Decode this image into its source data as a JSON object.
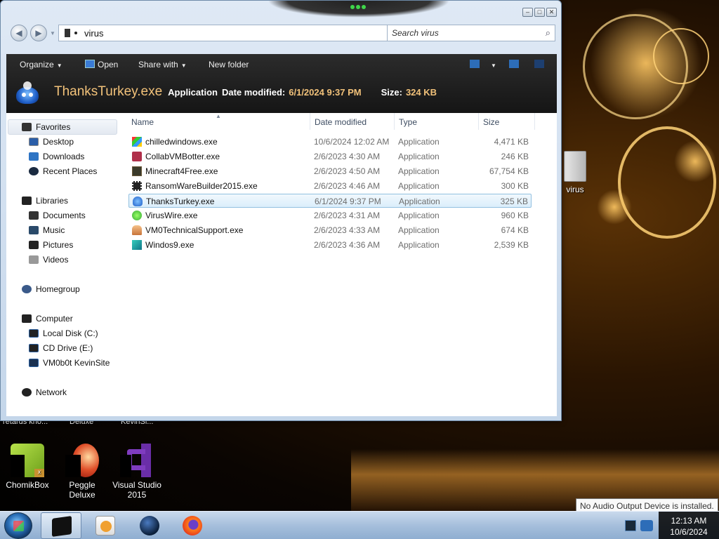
{
  "window": {
    "address": "virus",
    "search_placeholder": "Search virus",
    "toolbar": {
      "organize": "Organize",
      "open": "Open",
      "share_with": "Share with",
      "new_folder": "New folder"
    },
    "details": {
      "name": "ThanksTurkey.exe",
      "type": "Application",
      "date_label": "Date modified:",
      "date_value": "6/1/2024 9:37 PM",
      "size_label": "Size:",
      "size_value": "324 KB"
    },
    "nav": {
      "favorites": "Favorites",
      "desktop": "Desktop",
      "downloads": "Downloads",
      "recent_places": "Recent Places",
      "libraries": "Libraries",
      "documents": "Documents",
      "music": "Music",
      "pictures": "Pictures",
      "videos": "Videos",
      "homegroup": "Homegroup",
      "computer": "Computer",
      "local_disk": "Local Disk (C:)",
      "cd_drive": "CD Drive (E:)",
      "vm_site": "VM0b0t KevinSite",
      "network": "Network"
    },
    "columns": {
      "name": "Name",
      "date": "Date modified",
      "type": "Type",
      "size": "Size"
    },
    "files": [
      {
        "name": "chilledwindows.exe",
        "date": "10/6/2024 12:02 AM",
        "type": "Application",
        "size": "4,471 KB"
      },
      {
        "name": "CollabVMBotter.exe",
        "date": "2/6/2023 4:30 AM",
        "type": "Application",
        "size": "246 KB"
      },
      {
        "name": "Minecraft4Free.exe",
        "date": "2/6/2023 4:50 AM",
        "type": "Application",
        "size": "67,754 KB"
      },
      {
        "name": "RansomWareBuilder2015.exe",
        "date": "2/6/2023 4:46 AM",
        "type": "Application",
        "size": "300 KB"
      },
      {
        "name": "ThanksTurkey.exe",
        "date": "6/1/2024 9:37 PM",
        "type": "Application",
        "size": "325 KB"
      },
      {
        "name": "VirusWire.exe",
        "date": "2/6/2023 4:31 AM",
        "type": "Application",
        "size": "960 KB"
      },
      {
        "name": "VM0TechnicalSupport.exe",
        "date": "2/6/2023 4:33 AM",
        "type": "Application",
        "size": "674 KB"
      },
      {
        "name": "Windos9.exe",
        "date": "2/6/2023 4:36 AM",
        "type": "Application",
        "size": "2,539 KB"
      }
    ]
  },
  "desktop": {
    "virus_folder": "virus",
    "partial_1": "retards kno...",
    "partial_2": "Deluxe",
    "partial_3": "KevinSi...",
    "chomikbox": "ChomikBox",
    "peggle": "Peggle Deluxe",
    "vs_line1": "Visual Studio",
    "vs_line2": "2015"
  },
  "taskbar": {
    "time": "12:13 AM",
    "date": "10/6/2024",
    "tooltip": "No Audio Output Device is installed."
  },
  "colors": {
    "accent_orange": "#f2c27a",
    "selection": "#dbeefb"
  }
}
